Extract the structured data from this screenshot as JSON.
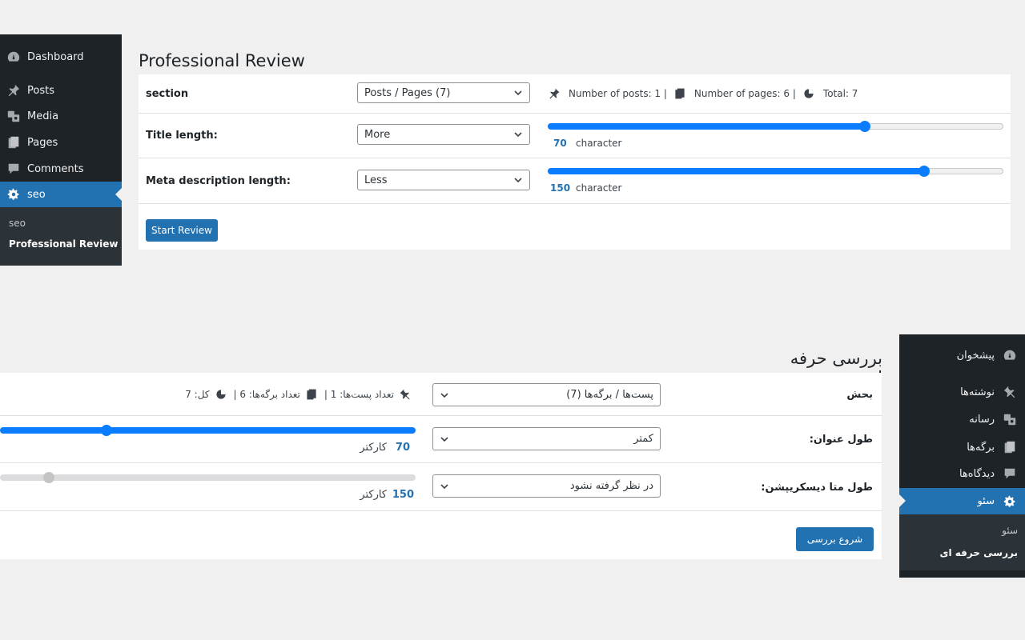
{
  "ltr": {
    "sidebar": {
      "items": [
        {
          "label": "Dashboard",
          "icon": "dashboard-icon"
        },
        {
          "label": "Posts",
          "icon": "pin-icon"
        },
        {
          "label": "Media",
          "icon": "media-icon"
        },
        {
          "label": "Pages",
          "icon": "pages-icon"
        },
        {
          "label": "Comments",
          "icon": "comment-icon"
        },
        {
          "label": "seo",
          "icon": "gear-icon"
        }
      ],
      "submenu": [
        "seo",
        "Professional Review"
      ]
    },
    "page_title": "Professional Review",
    "rows": {
      "section": {
        "label": "section",
        "value": "Posts / Pages (7)"
      },
      "title": {
        "label": "Title length:",
        "value": "More",
        "number": "70",
        "unit": "character",
        "level": 0.7
      },
      "meta": {
        "label": "Meta description length:",
        "value": "Less",
        "number": "150",
        "unit": "character",
        "level": 0.84
      }
    },
    "stats": {
      "posts": "Number of posts: 1 |",
      "pages": "Number of pages: 6 |",
      "total": "Total: 7"
    },
    "button": "Start Review"
  },
  "rtl": {
    "sidebar": {
      "items": [
        {
          "label": "پیشخوان",
          "icon": "dashboard-icon"
        },
        {
          "label": "نوشته‌ها",
          "icon": "pin-icon"
        },
        {
          "label": "رسانه",
          "icon": "media-icon"
        },
        {
          "label": "برگه‌ها",
          "icon": "pages-icon"
        },
        {
          "label": "دیدگاه‌ها",
          "icon": "comment-icon"
        },
        {
          "label": "سئو",
          "icon": "gear-icon"
        }
      ],
      "submenu": [
        "سئو",
        "بررسی حرفه ای"
      ]
    },
    "page_title": "بررسی حرفه ای",
    "rows": {
      "section": {
        "label": "بحش",
        "value": "پست‌ها / برگه‌ها (7)"
      },
      "title": {
        "label": "طول عنوان:",
        "value": "کمتر",
        "number": "70",
        "unit": "کارکتر"
      },
      "meta": {
        "label": "طول متا دیسکریپشن:",
        "value": "در نظر گرفته نشود",
        "number": "150",
        "unit": "کارکتر"
      }
    },
    "stats": {
      "posts": "تعداد پست‌ها: 1 |",
      "pages": "تعداد برگه‌ها: 6 |",
      "total": "کل: 7"
    },
    "button": "شروع بررسی"
  },
  "colors": {
    "sidebar": "#1d2327",
    "accent": "#2271b1",
    "slider": "#0a7cff"
  }
}
